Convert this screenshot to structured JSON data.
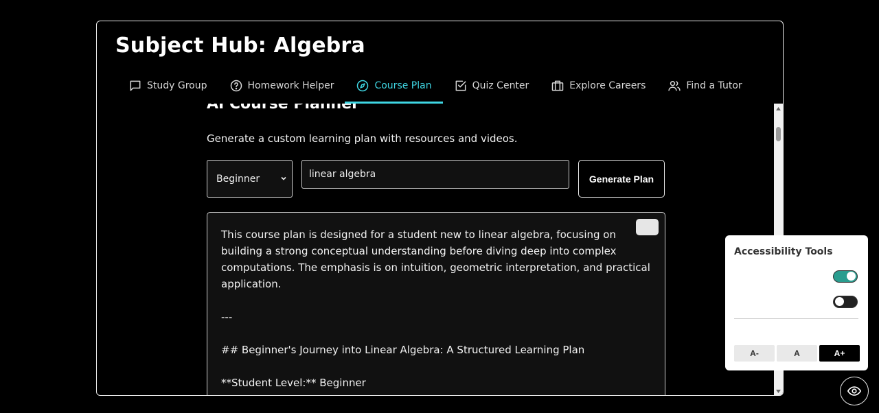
{
  "header": {
    "title": "Subject Hub: Algebra"
  },
  "tabs": [
    {
      "label": "Study Group",
      "icon": "chat-icon"
    },
    {
      "label": "Homework Helper",
      "icon": "help-circle-icon"
    },
    {
      "label": "Course Plan",
      "icon": "compass-icon",
      "active": true
    },
    {
      "label": "Quiz Center",
      "icon": "checkbox-icon"
    },
    {
      "label": "Explore Careers",
      "icon": "briefcase-icon"
    },
    {
      "label": "Find a Tutor",
      "icon": "users-icon"
    }
  ],
  "planner": {
    "title": "AI Course Planner",
    "description": "Generate a custom learning plan with resources and videos.",
    "level_value": "Beginner",
    "topic_value": "linear algebra",
    "generate_label": "Generate Plan",
    "output": {
      "intro": "This course plan is designed for a student new to linear algebra, focusing on building a strong conceptual understanding before diving deep into complex computations. The emphasis is on intuition, geometric interpretation, and practical application.",
      "separator": "---",
      "heading": "## Beginner's Journey into Linear Algebra: A Structured Learning Plan",
      "student_level": "**Student Level:** Beginner"
    }
  },
  "accessibility": {
    "title": "Accessibility Tools",
    "toggle_1_on": true,
    "toggle_2_on": false,
    "font_buttons": [
      "A-",
      "A",
      "A+"
    ]
  },
  "colors": {
    "accent": "#3fd6e3",
    "toggle_on": "#2a9d8f"
  }
}
